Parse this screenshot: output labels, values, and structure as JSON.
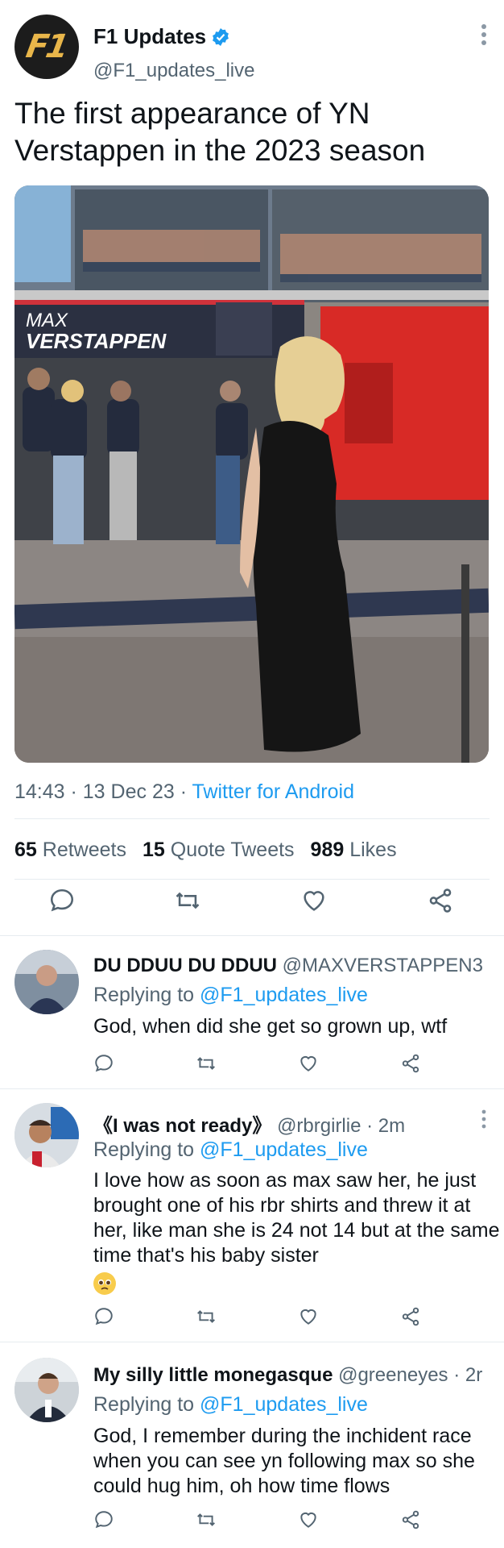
{
  "main_tweet": {
    "author_name": "F1 Updates",
    "handle": "@F1_updates_live",
    "avatar_text": "F1",
    "text": "The first appearance of YN Verstappen in the 2023 season",
    "photo_sign_line1": "MAX",
    "photo_sign_line2": "VERSTAPPEN",
    "time": "14:43",
    "date": "13 Dec 23",
    "via": "Twitter for Android",
    "retweets_count": "65",
    "retweets_label": "Retweets",
    "quotes_count": "15",
    "quotes_label": "Quote Tweets",
    "likes_count": "989",
    "likes_label": "Likes"
  },
  "replies": [
    {
      "name": "DU DDUU DU DDUU",
      "handle": "@MAXVERSTAPPEN3",
      "time": "",
      "replying_prefix": "Replying to",
      "replying_handle": "@F1_updates_live",
      "text": "God, when did she get so grown up, wtf"
    },
    {
      "name": "《I was not ready》",
      "handle": "@rbrgirlie",
      "time": "· 2m",
      "replying_prefix": "Replying to",
      "replying_handle": "@F1_updates_live",
      "text": "I love how as soon as max saw her, he just brought one of his rbr shirts and threw it at her, like man she is 24 not 14 but at the same time that's his baby sister",
      "emoji": "pleading-face"
    },
    {
      "name": "My silly little monegasque",
      "handle": "@greeneyes",
      "time": "· 2r",
      "replying_prefix": "Replying to",
      "replying_handle": "@F1_updates_live",
      "text": "God, I remember during the inchident race when you can see yn following max so she could hug him, oh how time flows"
    }
  ],
  "icons": {
    "reply": "speech-bubble-icon",
    "retweet": "retweet-icon",
    "like": "heart-icon",
    "share": "share-icon",
    "more": "more-vertical-icon",
    "verified": "verified-badge-icon"
  },
  "colors": {
    "link": "#1d9bf0",
    "secondary_text": "#536471",
    "primary_text": "#0f1419",
    "divider": "#e6ecf0"
  }
}
